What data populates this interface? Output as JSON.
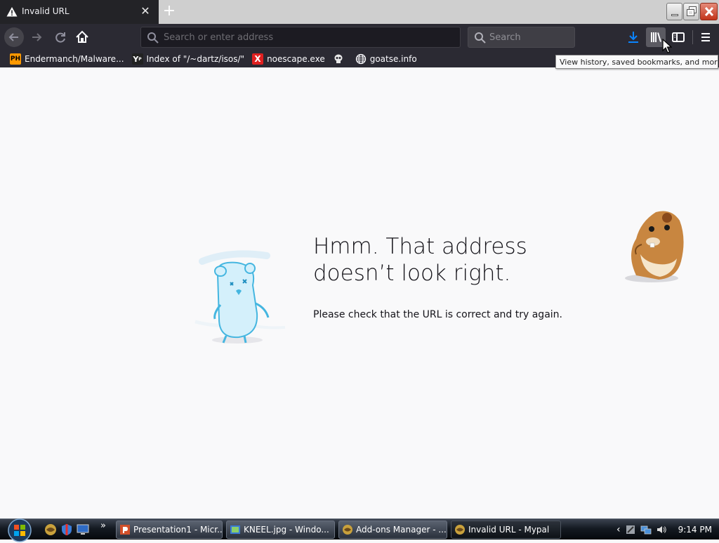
{
  "tab": {
    "title": "Invalid URL",
    "close_glyph": "✕",
    "newtab_glyph": "+"
  },
  "navbar": {
    "url_placeholder": "Search or enter address",
    "search_placeholder": "Search"
  },
  "bookmarks": [
    {
      "label": "Endermanch/Malware...",
      "icon": "PH"
    },
    {
      "label": "Index of \"/~dartz/isos/\"",
      "icon": "Y"
    },
    {
      "label": "noescape.exe",
      "icon": "X"
    },
    {
      "label": "",
      "icon": "skull"
    },
    {
      "label": "goatse.info",
      "icon": "globe"
    }
  ],
  "tooltip": "View history, saved bookmarks, and more",
  "error": {
    "title_line1": "Hmm. That address",
    "title_line2": "doesn’t look right.",
    "description": "Please check that the URL is correct and try again."
  },
  "taskbar": {
    "tasks": [
      {
        "label": "Presentation1 - Micr...",
        "icon": "powerpoint"
      },
      {
        "label": "KNEEL.jpg - Windo...",
        "icon": "photo-viewer"
      },
      {
        "label": "Add-ons Manager - ...",
        "icon": "browser"
      },
      {
        "label": "Invalid URL - Mypal",
        "icon": "browser"
      }
    ],
    "clock": "9:14 PM"
  },
  "colors": {
    "tab_active_bg": "#232327",
    "toolbar_bg": "#2b2a33",
    "urlbar_bg": "#1c1b22",
    "content_bg": "#f9f9fa",
    "accent_blue": "#0a84ff"
  }
}
